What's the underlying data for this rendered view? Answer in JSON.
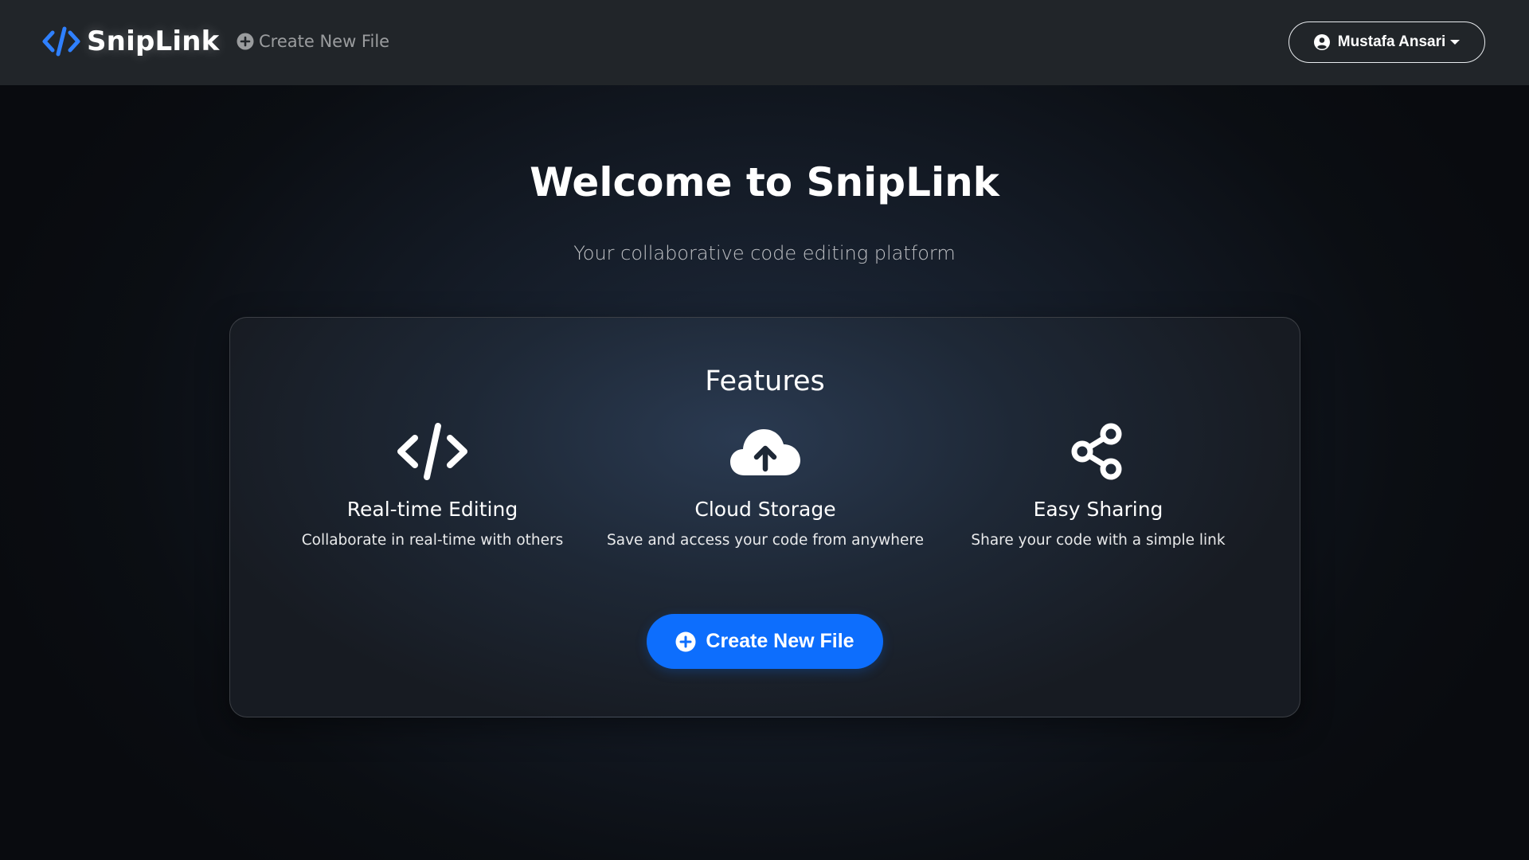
{
  "navbar": {
    "brand": "SnipLink",
    "create_link": "Create New File",
    "user_name": "Mustafa Ansari"
  },
  "hero": {
    "title": "Welcome to SnipLink",
    "subtitle": "Your collaborative code editing platform"
  },
  "features": {
    "heading": "Features",
    "items": [
      {
        "icon": "code-icon",
        "title": "Real-time Editing",
        "description": "Collaborate in real-time with others"
      },
      {
        "icon": "cloud-upload-icon",
        "title": "Cloud Storage",
        "description": "Save and access your code from anywhere"
      },
      {
        "icon": "share-icon",
        "title": "Easy Sharing",
        "description": "Share your code with a simple link"
      }
    ],
    "cta_label": "Create New File"
  },
  "colors": {
    "accent": "#0d6efd",
    "navbar_bg": "#212529",
    "brand_icon": "#2f80ff"
  }
}
